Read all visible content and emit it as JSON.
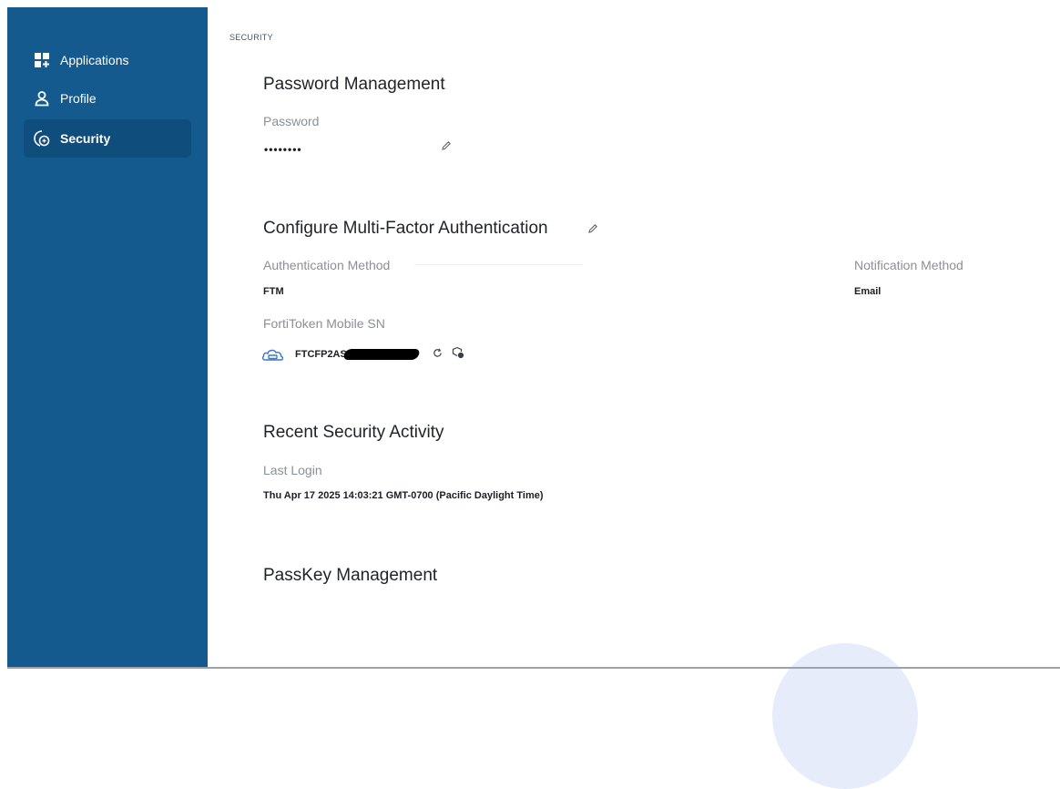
{
  "sidebar": {
    "items": [
      {
        "label": "Applications",
        "icon": "apps-grid-icon"
      },
      {
        "label": "Profile",
        "icon": "user-icon"
      },
      {
        "label": "Security",
        "icon": "security-shield-icon",
        "active": true
      }
    ]
  },
  "breadcrumb": "SECURITY",
  "password_section": {
    "title": "Password Management",
    "label": "Password",
    "value": "••••••••"
  },
  "mfa_section": {
    "title": "Configure Multi-Factor Authentication",
    "auth_method_label": "Authentication Method",
    "auth_method_value": "FTM",
    "notification_label": "Notification Method",
    "notification_value": "Email",
    "token_label": "FortiToken Mobile SN",
    "token_value": "FTCFP2ASL8"
  },
  "activity_section": {
    "title": "Recent Security Activity",
    "last_login_label": "Last Login",
    "last_login_value": "Thu Apr 17 2025 14:03:21 GMT-0700 (Pacific Daylight Time)"
  },
  "passkey_section": {
    "title": "PassKey Management"
  },
  "colors": {
    "sidebar": "#145a8e",
    "sidebar_active": "#0f4d7c",
    "heading": "#1f2328",
    "label": "#8a9098"
  }
}
